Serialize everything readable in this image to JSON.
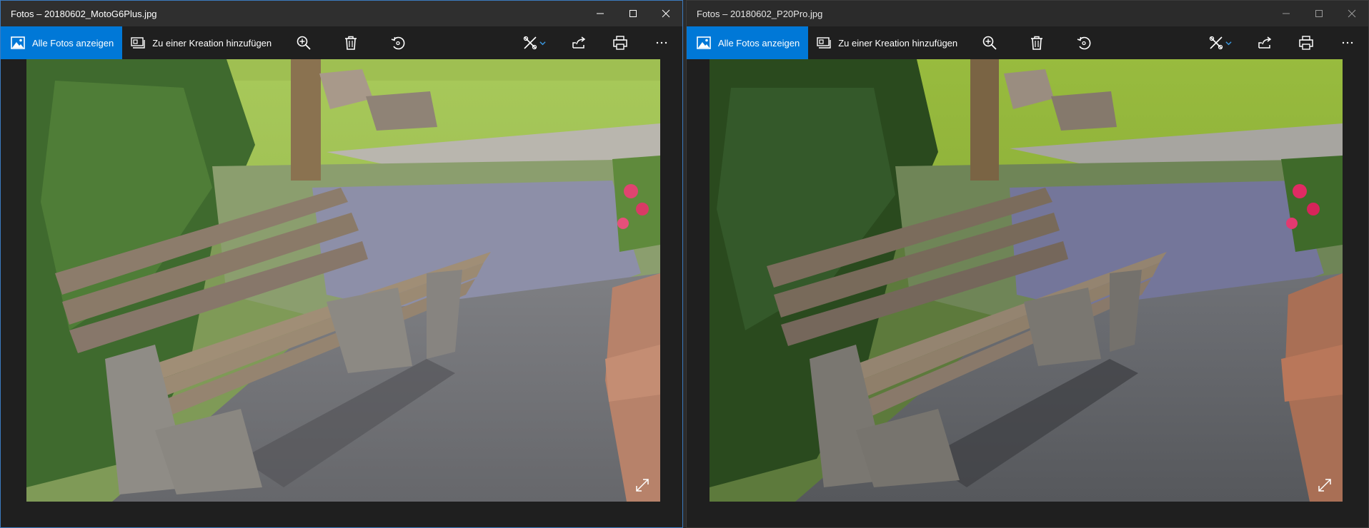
{
  "windows": [
    {
      "title": "Fotos – 20180602_MotoG6Plus.jpg",
      "toolbar": {
        "all_photos_label": "Alle Fotos anzeigen",
        "add_to_creation_label": "Zu einer Kreation hinzufügen"
      },
      "icons": [
        "picture-icon",
        "slideshow-icon",
        "zoom-in-icon",
        "delete-icon",
        "rotate-icon",
        "edit-icon",
        "chevron-down-icon",
        "share-icon",
        "print-icon",
        "more-icon",
        "expand-icon"
      ]
    },
    {
      "title": "Fotos – 20180602_P20Pro.jpg",
      "toolbar": {
        "all_photos_label": "Alle Fotos anzeigen",
        "add_to_creation_label": "Zu einer Kreation hinzufügen"
      },
      "icons": [
        "picture-icon",
        "slideshow-icon",
        "zoom-in-icon",
        "delete-icon",
        "rotate-icon",
        "edit-icon",
        "chevron-down-icon",
        "share-icon",
        "print-icon",
        "more-icon",
        "expand-icon"
      ]
    }
  ],
  "colors": {
    "accent": "#0078d7",
    "chrome": "#1f1f1f",
    "active_border": "#3b7bbf"
  }
}
